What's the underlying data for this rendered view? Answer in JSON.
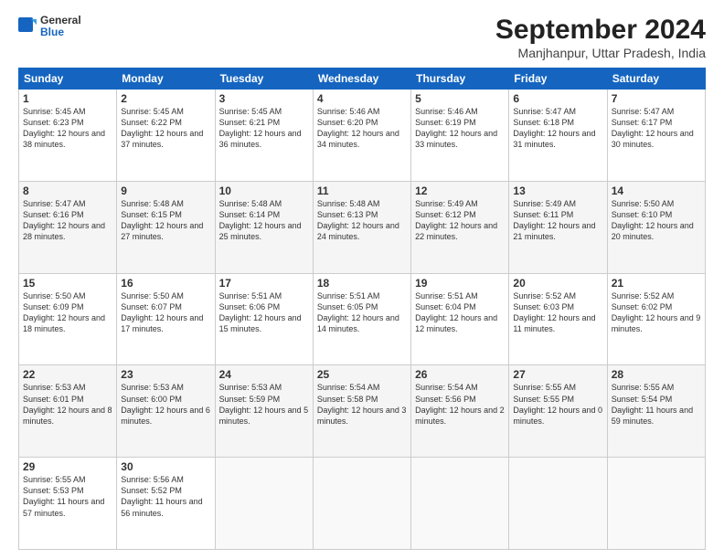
{
  "logo": {
    "line1": "General",
    "line2": "Blue"
  },
  "title": "September 2024",
  "subtitle": "Manjhanpur, Uttar Pradesh, India",
  "days_header": [
    "Sunday",
    "Monday",
    "Tuesday",
    "Wednesday",
    "Thursday",
    "Friday",
    "Saturday"
  ],
  "weeks": [
    [
      {
        "day": "1",
        "rise": "Sunrise: 5:45 AM",
        "set": "Sunset: 6:23 PM",
        "light": "Daylight: 12 hours and 38 minutes."
      },
      {
        "day": "2",
        "rise": "Sunrise: 5:45 AM",
        "set": "Sunset: 6:22 PM",
        "light": "Daylight: 12 hours and 37 minutes."
      },
      {
        "day": "3",
        "rise": "Sunrise: 5:45 AM",
        "set": "Sunset: 6:21 PM",
        "light": "Daylight: 12 hours and 36 minutes."
      },
      {
        "day": "4",
        "rise": "Sunrise: 5:46 AM",
        "set": "Sunset: 6:20 PM",
        "light": "Daylight: 12 hours and 34 minutes."
      },
      {
        "day": "5",
        "rise": "Sunrise: 5:46 AM",
        "set": "Sunset: 6:19 PM",
        "light": "Daylight: 12 hours and 33 minutes."
      },
      {
        "day": "6",
        "rise": "Sunrise: 5:47 AM",
        "set": "Sunset: 6:18 PM",
        "light": "Daylight: 12 hours and 31 minutes."
      },
      {
        "day": "7",
        "rise": "Sunrise: 5:47 AM",
        "set": "Sunset: 6:17 PM",
        "light": "Daylight: 12 hours and 30 minutes."
      }
    ],
    [
      {
        "day": "8",
        "rise": "Sunrise: 5:47 AM",
        "set": "Sunset: 6:16 PM",
        "light": "Daylight: 12 hours and 28 minutes."
      },
      {
        "day": "9",
        "rise": "Sunrise: 5:48 AM",
        "set": "Sunset: 6:15 PM",
        "light": "Daylight: 12 hours and 27 minutes."
      },
      {
        "day": "10",
        "rise": "Sunrise: 5:48 AM",
        "set": "Sunset: 6:14 PM",
        "light": "Daylight: 12 hours and 25 minutes."
      },
      {
        "day": "11",
        "rise": "Sunrise: 5:48 AM",
        "set": "Sunset: 6:13 PM",
        "light": "Daylight: 12 hours and 24 minutes."
      },
      {
        "day": "12",
        "rise": "Sunrise: 5:49 AM",
        "set": "Sunset: 6:12 PM",
        "light": "Daylight: 12 hours and 22 minutes."
      },
      {
        "day": "13",
        "rise": "Sunrise: 5:49 AM",
        "set": "Sunset: 6:11 PM",
        "light": "Daylight: 12 hours and 21 minutes."
      },
      {
        "day": "14",
        "rise": "Sunrise: 5:50 AM",
        "set": "Sunset: 6:10 PM",
        "light": "Daylight: 12 hours and 20 minutes."
      }
    ],
    [
      {
        "day": "15",
        "rise": "Sunrise: 5:50 AM",
        "set": "Sunset: 6:09 PM",
        "light": "Daylight: 12 hours and 18 minutes."
      },
      {
        "day": "16",
        "rise": "Sunrise: 5:50 AM",
        "set": "Sunset: 6:07 PM",
        "light": "Daylight: 12 hours and 17 minutes."
      },
      {
        "day": "17",
        "rise": "Sunrise: 5:51 AM",
        "set": "Sunset: 6:06 PM",
        "light": "Daylight: 12 hours and 15 minutes."
      },
      {
        "day": "18",
        "rise": "Sunrise: 5:51 AM",
        "set": "Sunset: 6:05 PM",
        "light": "Daylight: 12 hours and 14 minutes."
      },
      {
        "day": "19",
        "rise": "Sunrise: 5:51 AM",
        "set": "Sunset: 6:04 PM",
        "light": "Daylight: 12 hours and 12 minutes."
      },
      {
        "day": "20",
        "rise": "Sunrise: 5:52 AM",
        "set": "Sunset: 6:03 PM",
        "light": "Daylight: 12 hours and 11 minutes."
      },
      {
        "day": "21",
        "rise": "Sunrise: 5:52 AM",
        "set": "Sunset: 6:02 PM",
        "light": "Daylight: 12 hours and 9 minutes."
      }
    ],
    [
      {
        "day": "22",
        "rise": "Sunrise: 5:53 AM",
        "set": "Sunset: 6:01 PM",
        "light": "Daylight: 12 hours and 8 minutes."
      },
      {
        "day": "23",
        "rise": "Sunrise: 5:53 AM",
        "set": "Sunset: 6:00 PM",
        "light": "Daylight: 12 hours and 6 minutes."
      },
      {
        "day": "24",
        "rise": "Sunrise: 5:53 AM",
        "set": "Sunset: 5:59 PM",
        "light": "Daylight: 12 hours and 5 minutes."
      },
      {
        "day": "25",
        "rise": "Sunrise: 5:54 AM",
        "set": "Sunset: 5:58 PM",
        "light": "Daylight: 12 hours and 3 minutes."
      },
      {
        "day": "26",
        "rise": "Sunrise: 5:54 AM",
        "set": "Sunset: 5:56 PM",
        "light": "Daylight: 12 hours and 2 minutes."
      },
      {
        "day": "27",
        "rise": "Sunrise: 5:55 AM",
        "set": "Sunset: 5:55 PM",
        "light": "Daylight: 12 hours and 0 minutes."
      },
      {
        "day": "28",
        "rise": "Sunrise: 5:55 AM",
        "set": "Sunset: 5:54 PM",
        "light": "Daylight: 11 hours and 59 minutes."
      }
    ],
    [
      {
        "day": "29",
        "rise": "Sunrise: 5:55 AM",
        "set": "Sunset: 5:53 PM",
        "light": "Daylight: 11 hours and 57 minutes."
      },
      {
        "day": "30",
        "rise": "Sunrise: 5:56 AM",
        "set": "Sunset: 5:52 PM",
        "light": "Daylight: 11 hours and 56 minutes."
      },
      null,
      null,
      null,
      null,
      null
    ]
  ]
}
